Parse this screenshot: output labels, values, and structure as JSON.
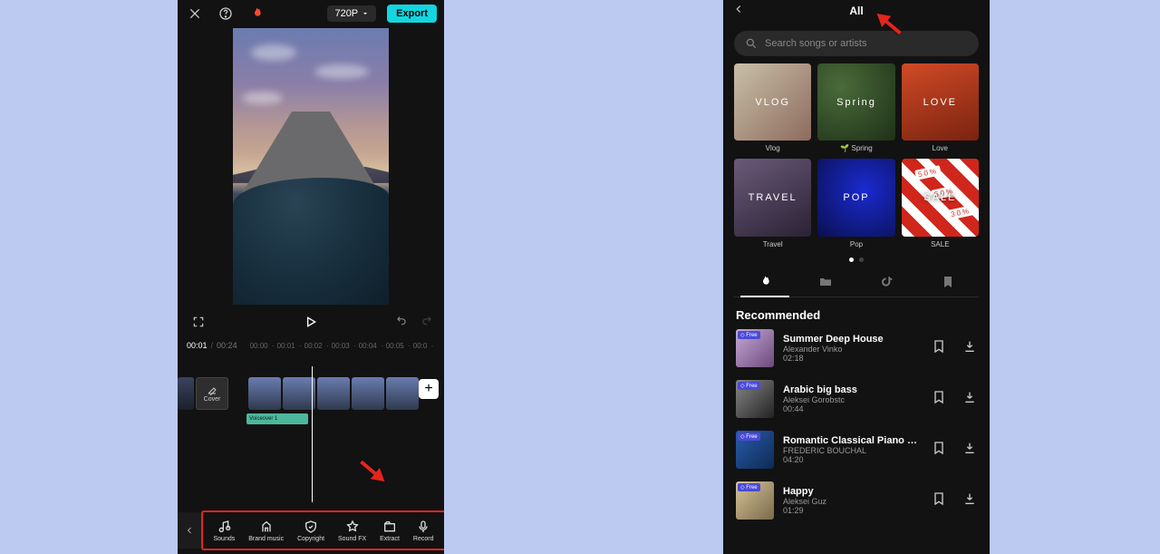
{
  "left": {
    "resolution": "720P",
    "export": "Export",
    "time_current": "00:01",
    "time_total": "00:24",
    "ruler": [
      "00:00",
      "00:01",
      "00:02",
      "00:03",
      "00:04",
      "00:05",
      "00:0"
    ],
    "cover_label": "Cover",
    "voiceover_label": "Voiceover 1",
    "tools": {
      "sounds": "Sounds",
      "brand": "Brand music",
      "copyright": "Copyright",
      "soundfx": "Sound FX",
      "extract": "Extract",
      "record": "Record"
    }
  },
  "right": {
    "title": "All",
    "search_placeholder": "Search songs or artists",
    "categories": [
      {
        "overlay": "VLOG",
        "label": "Vlog",
        "bg": "bg-vlog"
      },
      {
        "overlay": "Spring",
        "label": "🌱 Spring",
        "bg": "bg-spring"
      },
      {
        "overlay": "LOVE",
        "label": "Love",
        "bg": "bg-love"
      },
      {
        "overlay": "TRAVEL",
        "label": "Travel",
        "bg": "bg-travel"
      },
      {
        "overlay": "POP",
        "label": "Pop",
        "bg": "bg-pop"
      },
      {
        "overlay": "SALE",
        "label": "SALE",
        "bg": "bg-sale"
      }
    ],
    "section": "Recommended",
    "free_badge": "Free",
    "songs": [
      {
        "title": "Summer Deep House",
        "artist": "Alexander Vinko",
        "dur": "02:18"
      },
      {
        "title": "Arabic big bass",
        "artist": "Aleksei Gorobstc",
        "dur": "00:44"
      },
      {
        "title": "Romantic Classical Piano Solo",
        "artist": "FREDERIC BOUCHAL",
        "dur": "04:20"
      },
      {
        "title": "Happy",
        "artist": "Aleksei Guz",
        "dur": "01:29"
      }
    ]
  }
}
